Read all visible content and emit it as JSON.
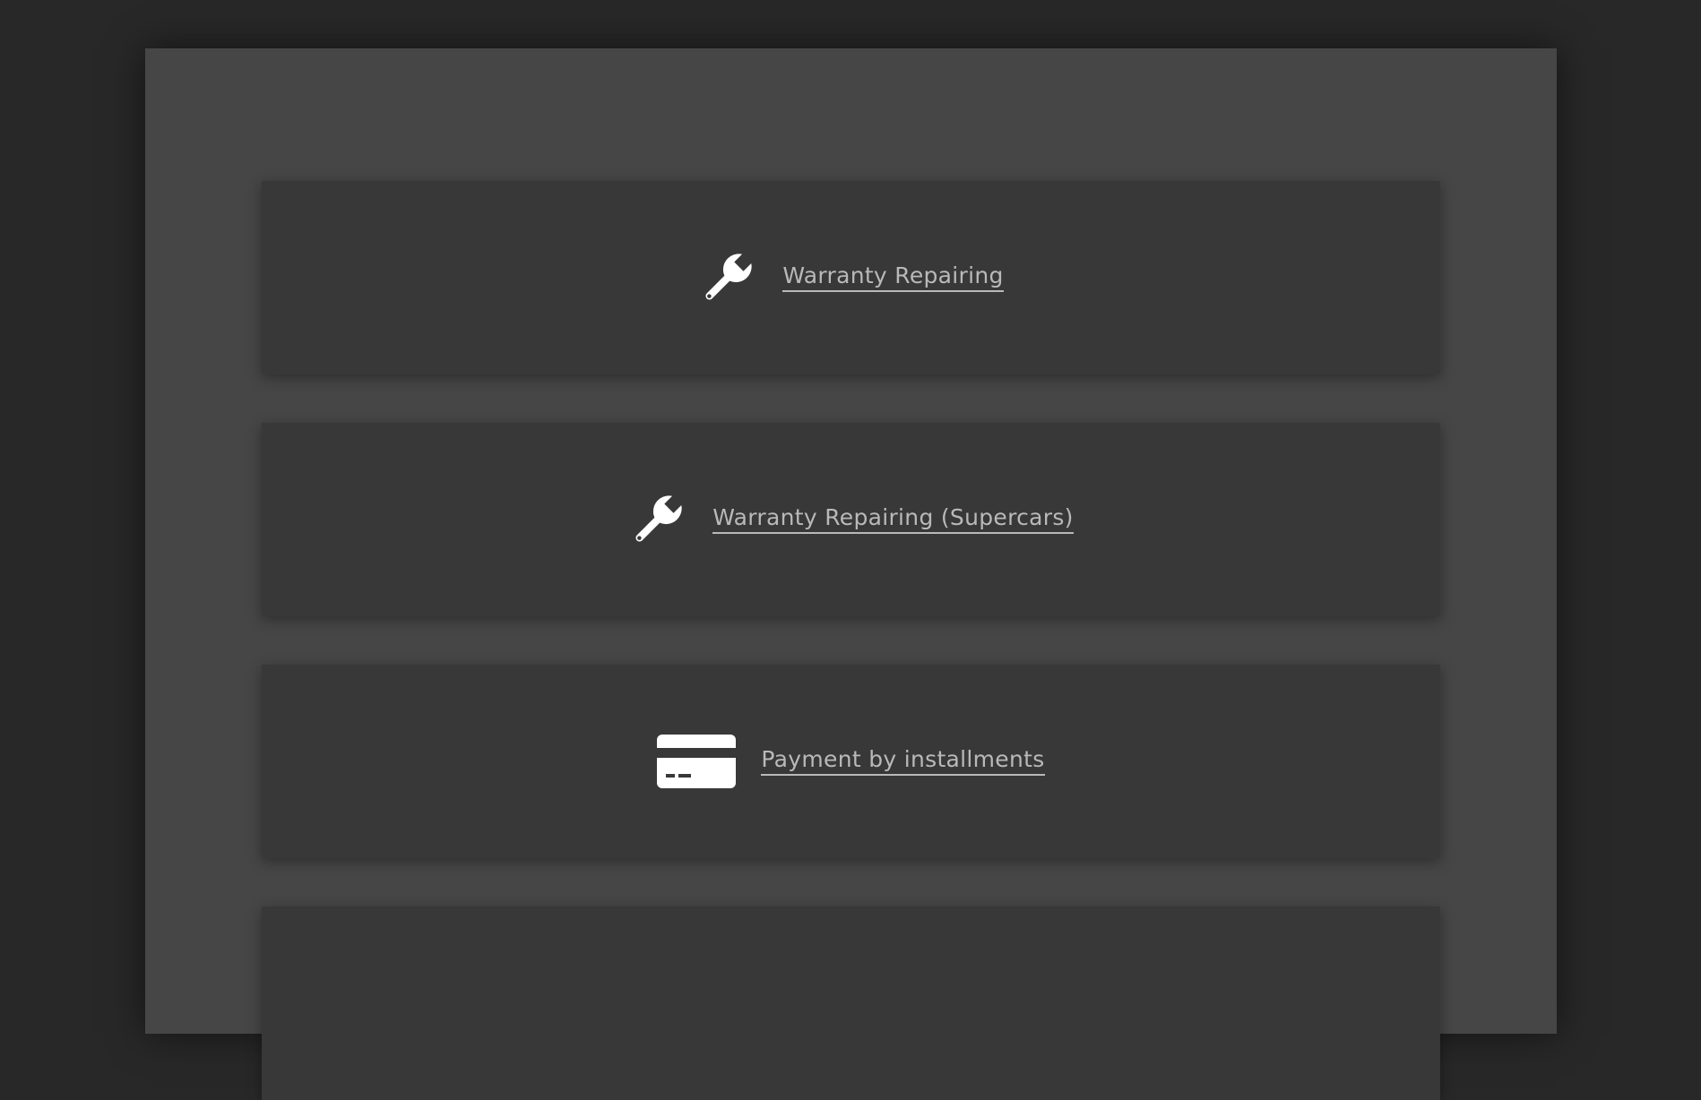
{
  "services": [
    {
      "label": "Warranty Repairing",
      "icon": "wrench-icon"
    },
    {
      "label": "Warranty Repairing (Supercars)",
      "icon": "wrench-icon"
    },
    {
      "label": "Payment by installments",
      "icon": "credit-card-icon"
    }
  ],
  "colors": {
    "background": "#282828",
    "page": "#464646",
    "card": "#383838",
    "link": "#b9b9b9",
    "icon": "#ffffff"
  }
}
